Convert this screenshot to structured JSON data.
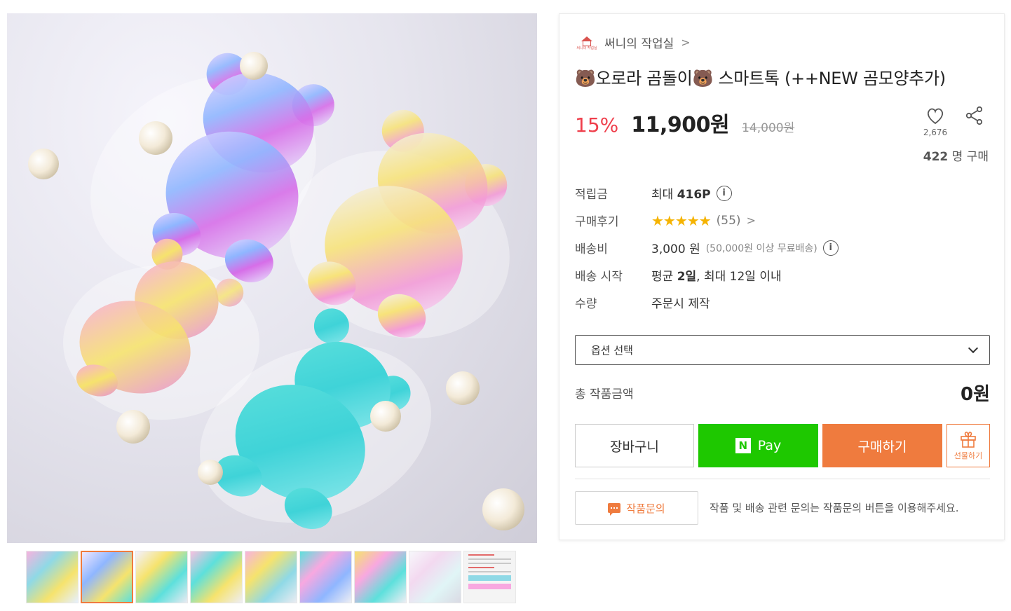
{
  "gallery": {
    "thumbnails": [
      "thumb-1",
      "thumb-2",
      "thumb-3",
      "thumb-4",
      "thumb-5",
      "thumb-6",
      "thumb-7",
      "thumb-8",
      "thumb-9"
    ],
    "active_index": 1
  },
  "store": {
    "name": "써니의 작업실",
    "logo_text": "써니의 작업실",
    "chevron": ">"
  },
  "product": {
    "title": "🐻오로라 곰돌이🐻 스마트톡 (++NEW 곰모양추가)",
    "discount": "15%",
    "price": "11,900원",
    "original_price": "14,000원",
    "likes": "2,676",
    "buyers_count": "422",
    "buyers_unit": " 명 구매"
  },
  "info": {
    "points_label": "적립금",
    "points_prefix": "최대 ",
    "points_value": "416P",
    "review_label": "구매후기",
    "review_stars": "★★★★★",
    "review_count": "(55)",
    "shipping_label": "배송비",
    "shipping_value": "3,000 원",
    "shipping_note": "(50,000원 이상 무료배송)",
    "start_label": "배송 시작",
    "start_prefix": "평균 ",
    "start_avg": "2일",
    "start_suffix": ", 최대 12일 이내",
    "qty_label": "수량",
    "qty_value": "주문시 제작",
    "info_icon": "i"
  },
  "option": {
    "placeholder": "옵션 선택"
  },
  "total": {
    "label": "총 작품금액",
    "value": "0원"
  },
  "buttons": {
    "cart": "장바구니",
    "npay_logo": "N",
    "npay": "Pay",
    "buy": "구매하기",
    "gift": "선물하기"
  },
  "inquiry": {
    "label": "작품문의",
    "note": "작품 및 배송 관련 문의는 작품문의 버튼을 이용해주세요."
  },
  "colors": {
    "accent": "#ef7b3e",
    "discount": "#ef3f4c",
    "npay": "#1ec800",
    "star": "#f5b301"
  }
}
